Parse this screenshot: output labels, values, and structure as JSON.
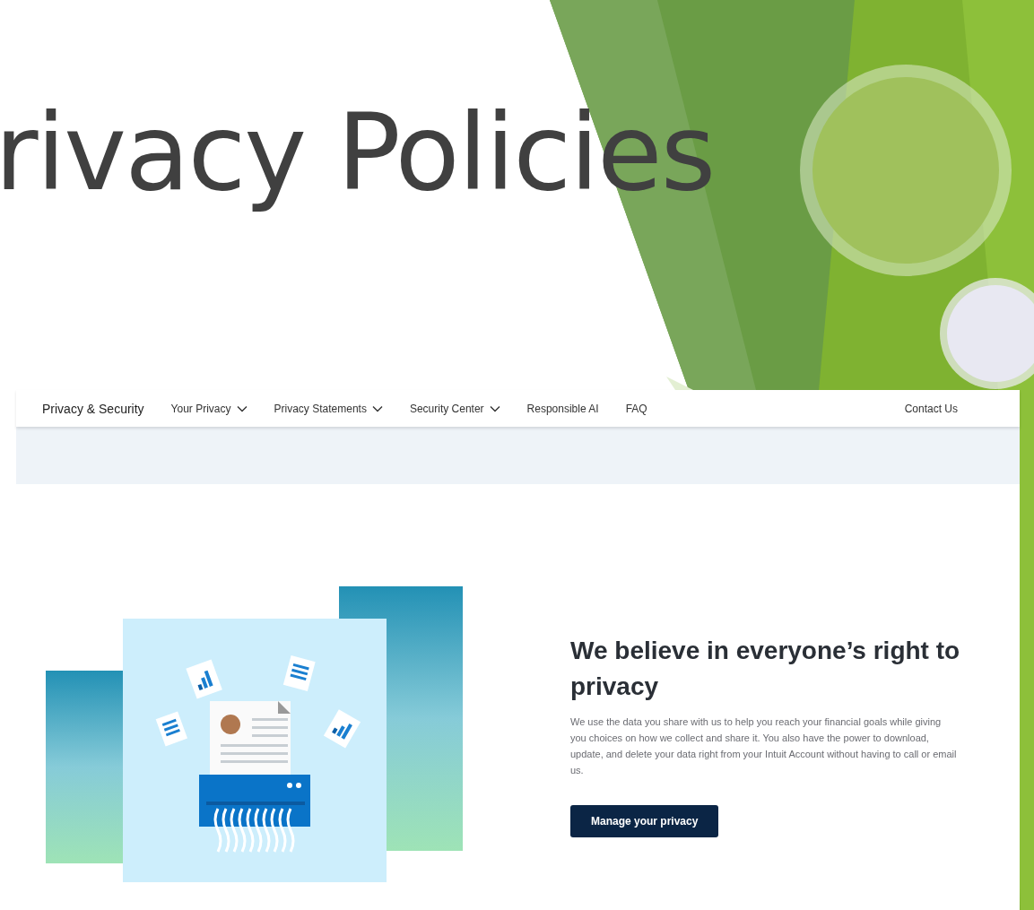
{
  "slide": {
    "title": "rivacy Policies"
  },
  "nav": {
    "brand": "Privacy & Security",
    "items": [
      {
        "label": "Your Privacy",
        "dropdown": true
      },
      {
        "label": "Privacy Statements",
        "dropdown": true
      },
      {
        "label": "Security Center",
        "dropdown": true
      },
      {
        "label": "Responsible AI",
        "dropdown": false
      },
      {
        "label": "FAQ",
        "dropdown": false
      }
    ],
    "contact": "Contact Us"
  },
  "hero": {
    "heading": "We believe in everyone’s right to privacy",
    "body": "We use the data you share with us to help you reach your financial goals while giving you choices on how we collect and share it. You also have the power to download, update, and delete your data right from your Intuit Account without having to call or email us.",
    "button": "Manage your privacy"
  }
}
